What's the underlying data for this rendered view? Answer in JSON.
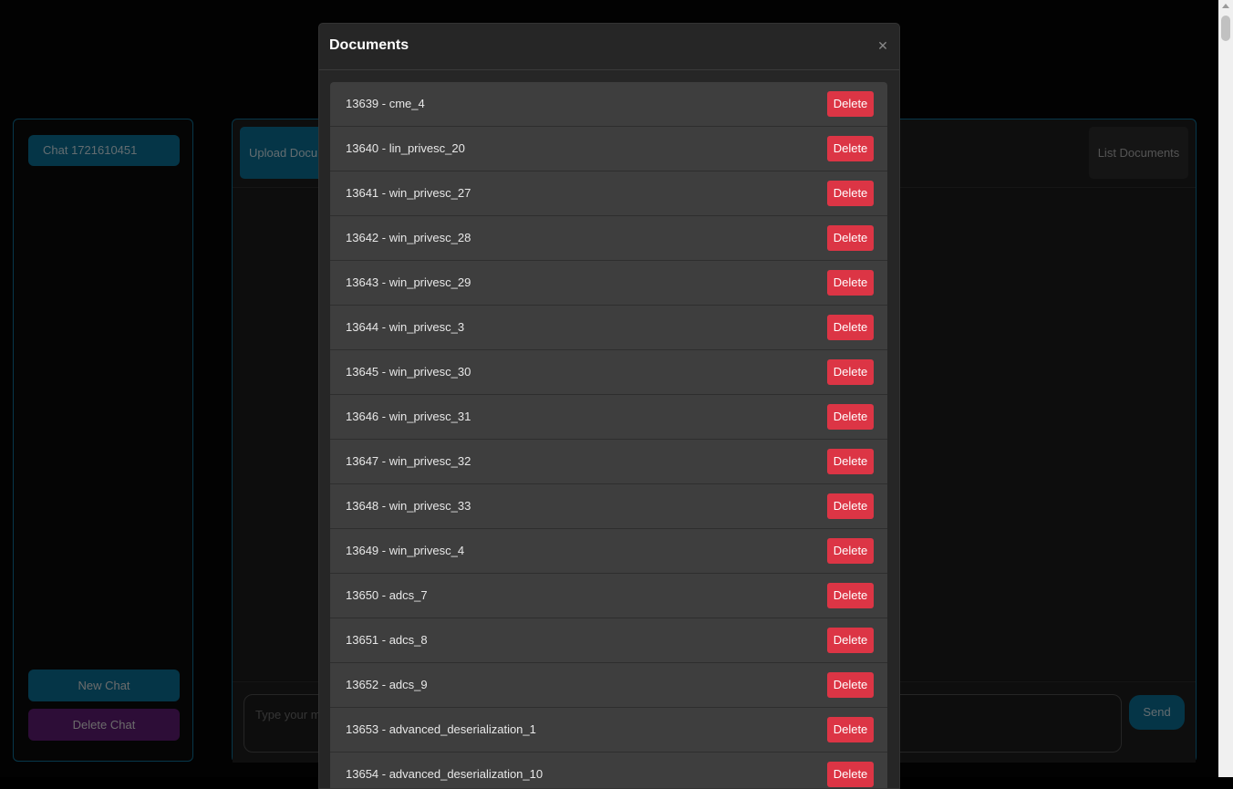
{
  "sidebar": {
    "chats": [
      "Chat 1721610451"
    ],
    "new_chat_label": "New Chat",
    "delete_chat_label": "Delete Chat"
  },
  "main": {
    "upload_label": "Upload Documents",
    "list_label": "List Documents",
    "input_placeholder": "Type your message...",
    "send_label": "Send"
  },
  "modal": {
    "title": "Documents",
    "close_icon": "close-icon",
    "delete_label": "Delete",
    "documents": [
      "13639 - cme_4",
      "13640 - lin_privesc_20",
      "13641 - win_privesc_27",
      "13642 - win_privesc_28",
      "13643 - win_privesc_29",
      "13644 - win_privesc_3",
      "13645 - win_privesc_30",
      "13646 - win_privesc_31",
      "13647 - win_privesc_32",
      "13648 - win_privesc_33",
      "13649 - win_privesc_4",
      "13650 - adcs_7",
      "13651 - adcs_8",
      "13652 - adcs_9",
      "13653 - advanced_deserialization_1",
      "13654 - advanced_deserialization_10"
    ]
  },
  "colors": {
    "accent": "#0a6b8e",
    "danger": "#dc3545",
    "purple": "#5b1a6e",
    "background": "#050505"
  }
}
